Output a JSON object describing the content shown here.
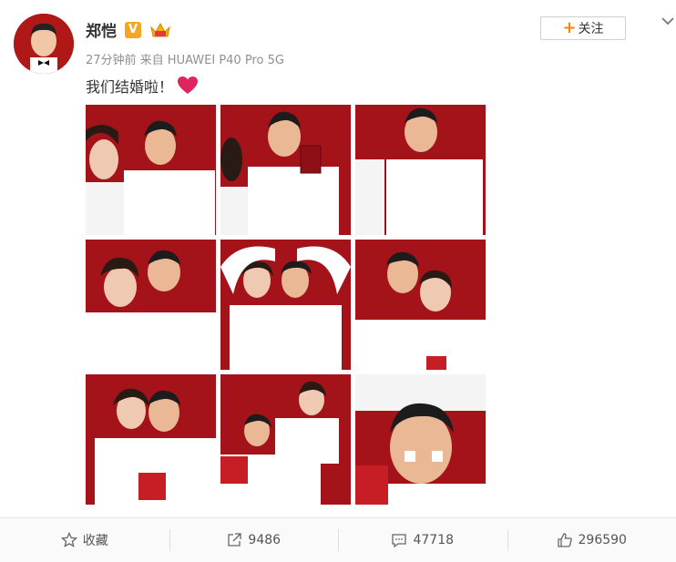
{
  "user": {
    "name": "郑恺",
    "verified_badge": "V",
    "meta": "27分钟前 来自 HUAWEI P40 Pro 5G",
    "follow_label": "关注",
    "follow_plus": "+"
  },
  "post": {
    "text": "我们结婚啦！"
  },
  "photos": [
    {
      "label": "photo-1"
    },
    {
      "label": "photo-2"
    },
    {
      "label": "photo-3"
    },
    {
      "label": "photo-4"
    },
    {
      "label": "photo-5"
    },
    {
      "label": "photo-6"
    },
    {
      "label": "photo-7"
    },
    {
      "label": "photo-8"
    },
    {
      "label": "photo-9"
    }
  ],
  "actions": {
    "favorite": "收藏",
    "repost": "9486",
    "comment": "47718",
    "like": "296590"
  },
  "colors": {
    "accent": "#ff8200",
    "photo_bg": "#a4131a",
    "heart": "#e0245e",
    "badge": "#f5a623"
  },
  "icons": [
    "star-icon",
    "share-icon",
    "comment-icon",
    "thumbs-up-icon",
    "chevron-down-icon",
    "heart-icon",
    "crown-icon"
  ]
}
